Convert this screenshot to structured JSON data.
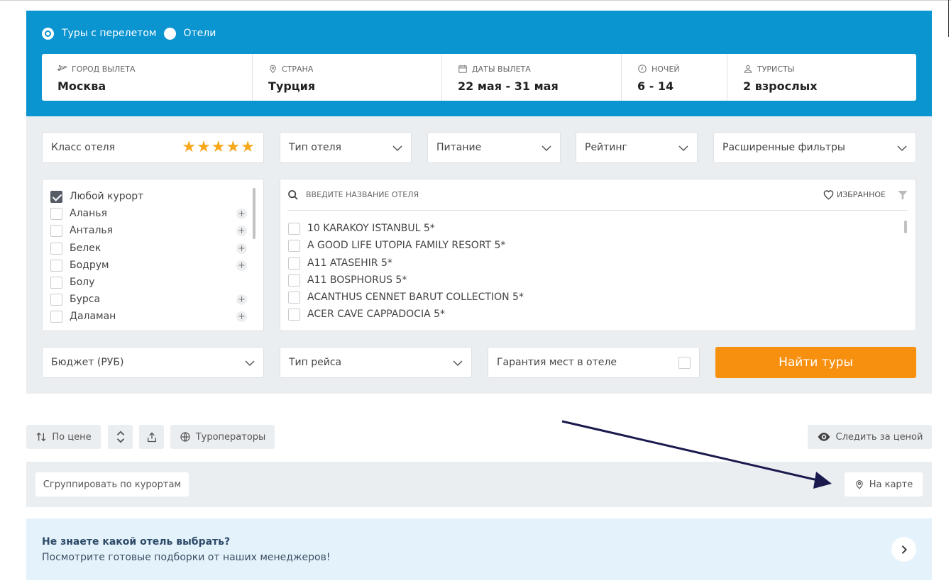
{
  "trip_type": {
    "options": [
      {
        "label": "Туры с перелетом",
        "selected": true
      },
      {
        "label": "Отели",
        "selected": false
      }
    ]
  },
  "search": {
    "departure": {
      "label": "ГОРОД ВЫЛЕТА",
      "value": "Москва",
      "icon": "plane-icon"
    },
    "country": {
      "label": "СТРАНА",
      "value": "Турция",
      "icon": "location-pin-icon"
    },
    "dates": {
      "label": "ДАТЫ ВЫЛЕТА",
      "value": "22 мая - 31 мая",
      "icon": "calendar-icon"
    },
    "nights": {
      "label": "НОЧЕЙ",
      "value": "6 - 14",
      "icon": "clock-icon"
    },
    "tourists": {
      "label": "ТУРИСТЫ",
      "value": "2 взрослых",
      "icon": "person-icon"
    }
  },
  "filters": {
    "hotel_class": {
      "label": "Класс отеля",
      "stars": 5
    },
    "hotel_type": "Тип отеля",
    "meals": "Питание",
    "rating": "Рейтинг",
    "advanced": "Расширенные фильтры",
    "budget": "Бюджет (РУБ)",
    "flight_type": "Тип рейса",
    "guarantee": "Гарантия мест в отеле"
  },
  "resorts": [
    {
      "name": "Любой курорт",
      "checked": true,
      "expandable": false
    },
    {
      "name": "Аланья",
      "checked": false,
      "expandable": true
    },
    {
      "name": "Анталья",
      "checked": false,
      "expandable": true
    },
    {
      "name": "Белек",
      "checked": false,
      "expandable": true
    },
    {
      "name": "Бодрум",
      "checked": false,
      "expandable": true
    },
    {
      "name": "Болу",
      "checked": false,
      "expandable": false
    },
    {
      "name": "Бурса",
      "checked": false,
      "expandable": true
    },
    {
      "name": "Даламан",
      "checked": false,
      "expandable": true
    }
  ],
  "hotel_search": {
    "placeholder": "введите название отеля",
    "favorites_label": "ИЗБРАННОЕ"
  },
  "hotels": [
    "10 KARAKOY ISTANBUL 5*",
    "A GOOD LIFE UTOPIA FAMILY RESORT 5*",
    "A11 ATASEHIR 5*",
    "A11 BOSPHORUS 5*",
    "ACANTHUS CENNET BARUT COLLECTION 5*",
    "ACER CAVE CAPPADOCIA 5*"
  ],
  "find_button": "Найти туры",
  "toolbar": {
    "sort_label": "По цене",
    "operators_label": "Туроператоры",
    "watch_price_label": "Следить за ценой"
  },
  "group_bar": {
    "group_label": "Сгруппировать по курортам",
    "map_label": "На карте"
  },
  "banner": {
    "title": "Не знаете какой отель выбрать?",
    "subtitle": "Посмотрите готовые подборки от наших менеджеров!"
  },
  "colors": {
    "header_blue": "#0a94d0",
    "panel_gray": "#ebeef1",
    "accent_orange": "#f8900f",
    "star_yellow": "#f7a81b",
    "annotation_arrow": "#1a1a4e"
  }
}
